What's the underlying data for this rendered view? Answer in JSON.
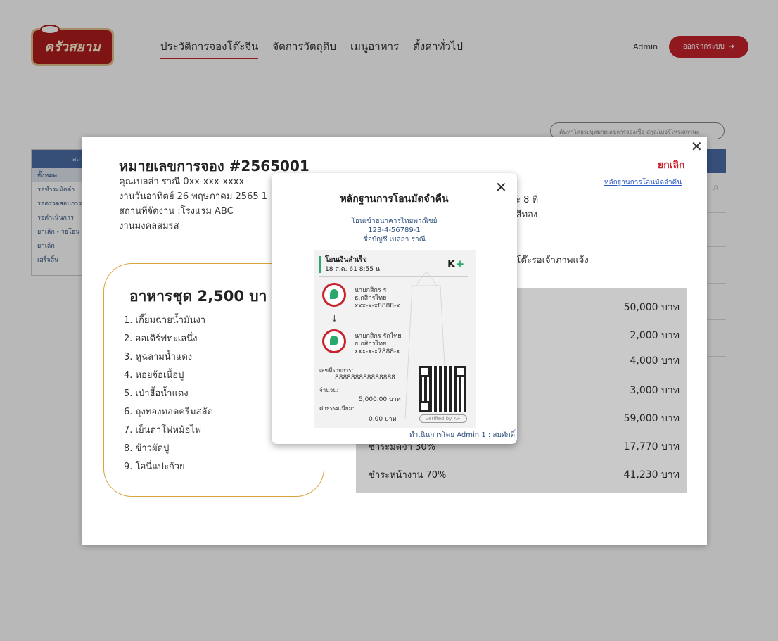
{
  "header": {
    "logo_text": "ครัวสยาม",
    "nav": [
      "ประวัติการจองโต๊ะจีน",
      "จัดการวัตถุดิบ",
      "เมนูอาหาร",
      "ตั้งค่าทั่วไป"
    ],
    "admin_label": "Admin",
    "logout_label": "ออกจากระบบ",
    "logout_icon": "arrow-right-icon"
  },
  "search": {
    "placeholder": "ค้นหาโดยระบุหมายเลขการจอง/ชื่อ-สกุล/เบอร์โทร/สถานะ"
  },
  "sidebar": {
    "title": "สถาน",
    "items": [
      "ทั้งหมด",
      "รอชำระมัดจำ",
      "รอตรวจสอบการ",
      "รอดำเนินการ",
      "ยกเลิก - รอโอน",
      "ยกเลิก",
      "เสร็จสิ้น"
    ]
  },
  "booking": {
    "title": "หมายเลขการจอง #2565001",
    "customer": "คุณเบลล่า ราณี 0xx-xxx-xxxx",
    "event_date": "งานวันอาทิตย์ 26 พฤษภาคม 2565 1",
    "venue": "สถานที่จัดงาน :โรงแรม ABC",
    "event_type": "งานมงคลสมรส",
    "status": "ยกเลิก",
    "refund_link": "หลักฐานการโอนมัดจำคืน",
    "right_info_1": "ละ 8 ที่",
    "right_info_2": ": สีทอง",
    "table_note": "0 โต๊ะรอเจ้าภาพแจ้ง",
    "menu": {
      "title": "อาหารชุด 2,500 บา",
      "items": [
        "1. เกี๊ยมฉ่ายน้ำมันงา",
        "2. ออเดิร์ฟทะเลนึ่ง",
        "3. หูฉลามน้ำแดง",
        "4. หอยจ้อเนื้อปู",
        "5. เป่าฮื้อน้ำแดง",
        "6. ถุงทองทอดครีมสลัด",
        "7. เย็นตาโฟหม้อไฟ",
        "8. ข้าวผัดปู",
        "9. โอนี่แปะก้วย"
      ]
    },
    "prices": [
      "50,000 บาท",
      "2,000 บาท",
      "4,000 บาท",
      "3,000 บาท",
      "59,000 บาท",
      "17,770 บาท",
      "41,230 บาท"
    ],
    "price_labels": {
      "deposit": "ชำระมัดจำ 30%",
      "remaining": "ชำระหน้างาน 70%"
    }
  },
  "refund_modal": {
    "title": "หลักฐานการโอนมัดจำคืน",
    "bank_line": "โอนเข้าธนาคารไทยพาณิชย์",
    "account_no": "123-4-56789-1",
    "account_name": "ชื่อบัญชี เบลล่า ราณี",
    "operator": "ดำเนินการโดย Admin 1 : สมศักดิ์",
    "slip": {
      "status": "โอนเงินสำเร็จ",
      "datetime": "18 ส.ค. 61 8:55 น.",
      "brand": "K+",
      "sender_name": "นายกสิกร ร",
      "sender_bank": "ธ.กสิกรไทย",
      "sender_acc": "xxx-x-x8888-x",
      "receiver_name": "นายกสิกร รักไทย",
      "receiver_bank": "ธ.กสิกรไทย",
      "receiver_acc": "xxx-x-x7888-x",
      "ref_label": "เลขที่รายการ:",
      "ref_value": "888888888888888",
      "amount_label": "จำนวน:",
      "amount_value": "5,000.00 บาท",
      "fee_label": "ค่าธรรมเนียม:",
      "fee_value": "0.00 บาท",
      "verified": "verified by K+"
    }
  }
}
